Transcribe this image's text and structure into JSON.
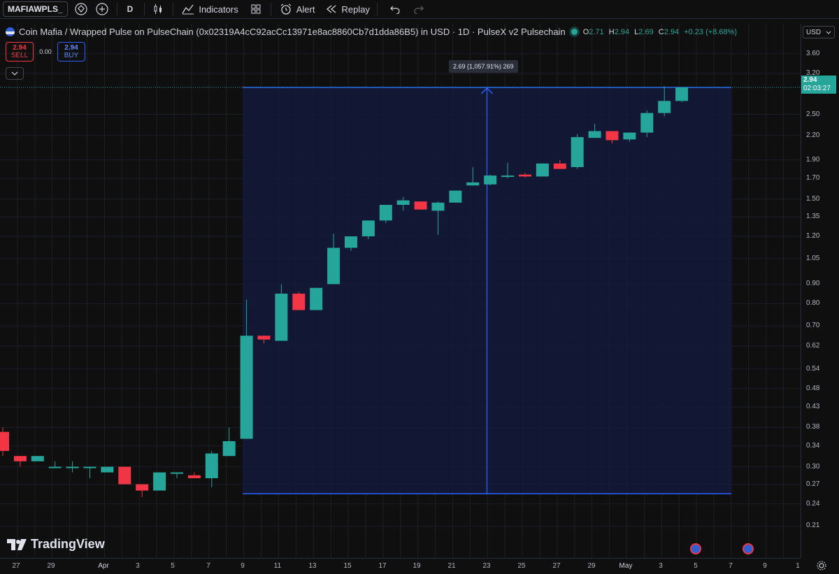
{
  "toolbar": {
    "symbol": "MAFIAWPLS_",
    "interval": "D",
    "indicators_label": "Indicators",
    "alert_label": "Alert",
    "replay_label": "Replay"
  },
  "legend": {
    "title": "Coin Mafia / Wrapped Pulse on PulseChain (0x02319A4cC92acCc13971e8ac8860Cb7d1dda86B5) in USD · 1D · PulseX v2 Pulsechain",
    "o_label": "O",
    "o": "2.71",
    "h_label": "H",
    "h": "2.94",
    "l_label": "L",
    "l": "2.69",
    "c_label": "C",
    "c": "2.94",
    "change": "+0.23 (+8.68%)"
  },
  "trade": {
    "sell_price": "2.94",
    "sell_label": "SELL",
    "spread": "0.00",
    "buy_price": "2.94",
    "buy_label": "BUY"
  },
  "price_axis": {
    "currency": "USD",
    "labels": [
      "3.60",
      "3.20",
      "2.50",
      "2.20",
      "1.90",
      "1.70",
      "1.50",
      "1.35",
      "1.20",
      "1.05",
      "0.90",
      "0.80",
      "0.70",
      "0.62",
      "0.54",
      "0.48",
      "0.43",
      "0.38",
      "0.34",
      "0.30",
      "0.27",
      "0.24",
      "0.21"
    ],
    "last_price": "2.94",
    "countdown": "02:03:27"
  },
  "time_axis": {
    "labels": [
      "27",
      "29",
      "Apr",
      "3",
      "5",
      "7",
      "9",
      "11",
      "13",
      "15",
      "17",
      "19",
      "21",
      "23",
      "25",
      "27",
      "29",
      "May",
      "3",
      "5",
      "7",
      "9",
      "1"
    ]
  },
  "measure": {
    "label": "2.69 (1,057.91%) 269",
    "from_price": 0.255,
    "to_price": 2.94
  },
  "branding": {
    "logo_text": "TradingView"
  },
  "colors": {
    "up": "#26a69a",
    "down": "#f23645",
    "measure_fill": "#131a3a",
    "measure_line": "#2962ff"
  },
  "chart_data": {
    "type": "candlestick",
    "scale": "log",
    "ylim": [
      0.2,
      3.8
    ],
    "candles": [
      {
        "o": 0.37,
        "h": 0.38,
        "l": 0.32,
        "c": 0.33
      },
      {
        "o": 0.32,
        "h": 0.32,
        "l": 0.3,
        "c": 0.31
      },
      {
        "o": 0.31,
        "h": 0.32,
        "l": 0.31,
        "c": 0.32
      },
      {
        "o": 0.3,
        "h": 0.31,
        "l": 0.3,
        "c": 0.3
      },
      {
        "o": 0.3,
        "h": 0.31,
        "l": 0.29,
        "c": 0.3
      },
      {
        "o": 0.3,
        "h": 0.3,
        "l": 0.28,
        "c": 0.3
      },
      {
        "o": 0.29,
        "h": 0.3,
        "l": 0.29,
        "c": 0.3
      },
      {
        "o": 0.3,
        "h": 0.3,
        "l": 0.27,
        "c": 0.27
      },
      {
        "o": 0.27,
        "h": 0.27,
        "l": 0.25,
        "c": 0.26
      },
      {
        "o": 0.26,
        "h": 0.29,
        "l": 0.26,
        "c": 0.29
      },
      {
        "o": 0.29,
        "h": 0.29,
        "l": 0.28,
        "c": 0.29
      },
      {
        "o": 0.285,
        "h": 0.29,
        "l": 0.28,
        "c": 0.28
      },
      {
        "o": 0.28,
        "h": 0.33,
        "l": 0.265,
        "c": 0.325
      },
      {
        "o": 0.32,
        "h": 0.38,
        "l": 0.32,
        "c": 0.35
      },
      {
        "o": 0.355,
        "h": 0.82,
        "l": 0.355,
        "c": 0.66
      },
      {
        "o": 0.66,
        "h": 0.66,
        "l": 0.63,
        "c": 0.645
      },
      {
        "o": 0.64,
        "h": 0.9,
        "l": 0.64,
        "c": 0.85
      },
      {
        "o": 0.85,
        "h": 0.86,
        "l": 0.77,
        "c": 0.77
      },
      {
        "o": 0.77,
        "h": 0.88,
        "l": 0.77,
        "c": 0.88
      },
      {
        "o": 0.9,
        "h": 1.22,
        "l": 0.9,
        "c": 1.12
      },
      {
        "o": 1.12,
        "h": 1.2,
        "l": 1.1,
        "c": 1.2
      },
      {
        "o": 1.2,
        "h": 1.32,
        "l": 1.18,
        "c": 1.32
      },
      {
        "o": 1.32,
        "h": 1.45,
        "l": 1.3,
        "c": 1.45
      },
      {
        "o": 1.45,
        "h": 1.52,
        "l": 1.4,
        "c": 1.49
      },
      {
        "o": 1.48,
        "h": 1.48,
        "l": 1.41,
        "c": 1.41
      },
      {
        "o": 1.4,
        "h": 1.48,
        "l": 1.21,
        "c": 1.47
      },
      {
        "o": 1.47,
        "h": 1.58,
        "l": 1.47,
        "c": 1.58
      },
      {
        "o": 1.63,
        "h": 1.82,
        "l": 1.63,
        "c": 1.66
      },
      {
        "o": 1.64,
        "h": 1.74,
        "l": 1.63,
        "c": 1.73
      },
      {
        "o": 1.73,
        "h": 1.87,
        "l": 1.7,
        "c": 1.73
      },
      {
        "o": 1.74,
        "h": 1.76,
        "l": 1.71,
        "c": 1.72
      },
      {
        "o": 1.72,
        "h": 1.86,
        "l": 1.72,
        "c": 1.86
      },
      {
        "o": 1.86,
        "h": 1.9,
        "l": 1.8,
        "c": 1.8
      },
      {
        "o": 1.82,
        "h": 2.22,
        "l": 1.8,
        "c": 2.18
      },
      {
        "o": 2.17,
        "h": 2.36,
        "l": 2.17,
        "c": 2.26
      },
      {
        "o": 2.26,
        "h": 2.26,
        "l": 2.1,
        "c": 2.14
      },
      {
        "o": 2.15,
        "h": 2.24,
        "l": 2.12,
        "c": 2.24
      },
      {
        "o": 2.24,
        "h": 2.56,
        "l": 2.18,
        "c": 2.52
      },
      {
        "o": 2.52,
        "h": 2.96,
        "l": 2.47,
        "c": 2.71
      },
      {
        "o": 2.71,
        "h": 2.94,
        "l": 2.69,
        "c": 2.94
      }
    ]
  }
}
